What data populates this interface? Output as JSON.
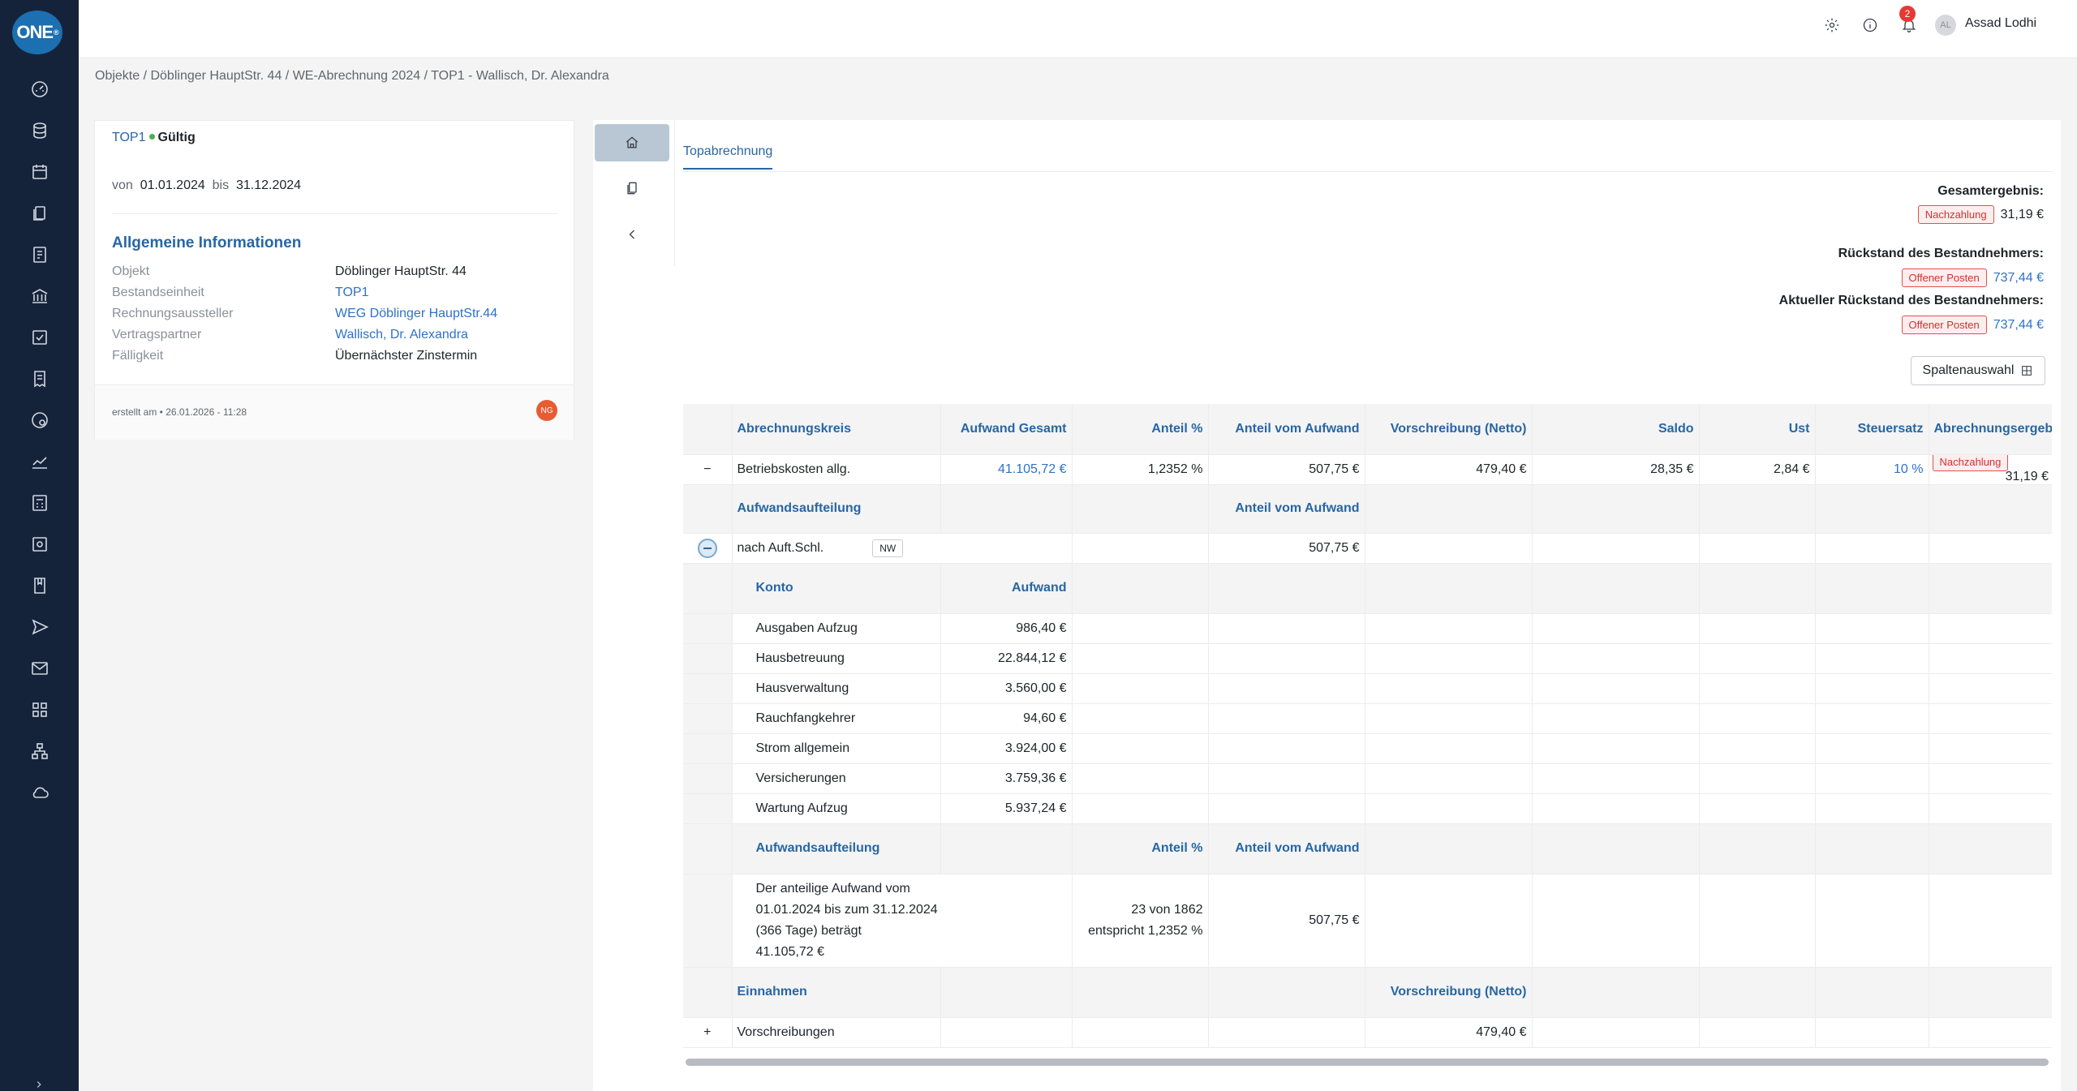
{
  "app": {
    "logo_text": "ONE",
    "logo_mark": "®"
  },
  "sidebar": {
    "items": [
      "dashboard-icon",
      "database-icon",
      "calendar-icon",
      "documents-icon",
      "invoice-icon",
      "bank-icon",
      "tasks-icon",
      "receipt-icon",
      "settings-coin-icon",
      "chart-icon",
      "calculator-icon",
      "photo-icon",
      "book-icon",
      "send-icon",
      "mail-icon",
      "apps-icon",
      "hierarchy-icon",
      "cloud-icon"
    ]
  },
  "topbar": {
    "notification_count": "2",
    "user_initials": "AL",
    "user_name": "Assad Lodhi"
  },
  "breadcrumb": "Objekte / Döblinger HauptStr. 44 / WE-Abrechnung 2024 / TOP1 - Wallisch, Dr. Alexandra",
  "info": {
    "top_id": "TOP1",
    "status": "Gültig",
    "von_label": "von",
    "von": "01.01.2024",
    "bis_label": "bis",
    "bis": "31.12.2024",
    "section_title": "Allgemeine Informationen",
    "fields": [
      {
        "label": "Objekt",
        "value": "Döblinger HauptStr. 44"
      },
      {
        "label": "Bestandseinheit",
        "value": "TOP1"
      },
      {
        "label": "Rechnungsaussteller",
        "value": "WEG Döblinger HauptStr.44"
      },
      {
        "label": "Vertragspartner",
        "value": "Wallisch, Dr. Alexandra"
      },
      {
        "label": "Fälligkeit",
        "value": "Übernächster Zinstermin"
      }
    ],
    "created": "erstellt am  •  26.01.2026 - 11:28",
    "creator_initials": "NG"
  },
  "tabs": {
    "active": "Topabrechnung"
  },
  "summary": {
    "gesamt_label": "Gesamtergebnis:",
    "gesamt_tag": "Nachzahlung",
    "gesamt_value": "31,19 €",
    "rueckstand_label": "Rückstand des Bestandnehmers:",
    "rueckstand_tag": "Offener Posten",
    "rueckstand_value": "737,44 €",
    "akt_label": "Aktueller Rückstand des Bestandnehmers:",
    "akt_tag": "Offener Posten",
    "akt_value": "737,44 €",
    "spalten_button": "Spaltenauswahl"
  },
  "table": {
    "headers": [
      "Abrechnungskreis",
      "Aufwand Gesamt",
      "Anteil %",
      "Anteil vom Aufwand",
      "Vorschreibung (Netto)",
      "Saldo",
      "Ust",
      "Steuersatz",
      "Abrechnungsergebnis"
    ],
    "main_row": {
      "toggle": "−",
      "name": "Betriebskosten allg.",
      "aufwand": "41.105,72 €",
      "anteil_pct": "1,2352 %",
      "anteil_aufwand": "507,75 €",
      "vorschreibung": "479,40 €",
      "saldo": "28,35 €",
      "ust": "2,84 €",
      "steuersatz": "10 %",
      "tag": "Nachzahlung",
      "ergebnis": "31,19 €"
    },
    "aufteilung_header": {
      "label": "Aufwandsaufteilung",
      "col": "Anteil vom Aufwand"
    },
    "auft_row": {
      "name": "nach Auft.Schl.",
      "tag": "NW",
      "value": "507,75 €"
    },
    "konto_header": {
      "konto": "Konto",
      "aufwand": "Aufwand"
    },
    "konten": [
      {
        "name": "Ausgaben Aufzug",
        "value": "986,40 €"
      },
      {
        "name": "Hausbetreuung",
        "value": "22.844,12 €"
      },
      {
        "name": "Hausverwaltung",
        "value": "3.560,00 €"
      },
      {
        "name": "Rauchfangkehrer",
        "value": "94,60 €"
      },
      {
        "name": "Strom allgemein",
        "value": "3.924,00 €"
      },
      {
        "name": "Versicherungen",
        "value": "3.759,36 €"
      },
      {
        "name": "Wartung Aufzug",
        "value": "5.937,24 €"
      }
    ],
    "aufteilung2_header": {
      "label": "Aufwandsaufteilung",
      "pct": "Anteil %",
      "col": "Anteil vom Aufwand"
    },
    "aufteilung2_row": {
      "line1": "Der anteilige Aufwand vom",
      "line2": "01.01.2024 bis zum 31.12.2024",
      "line3": "(366 Tage) beträgt",
      "line4": "41.105,72 €",
      "pct1": "23 von 1862",
      "pct2": "entspricht 1,2352 %",
      "value": "507,75 €"
    },
    "einnahmen_header": {
      "label": "Einnahmen",
      "col": "Vorschreibung (Netto)"
    },
    "einnahmen_row": {
      "toggle": "+",
      "name": "Vorschreibungen",
      "value": "479,40 €"
    }
  }
}
